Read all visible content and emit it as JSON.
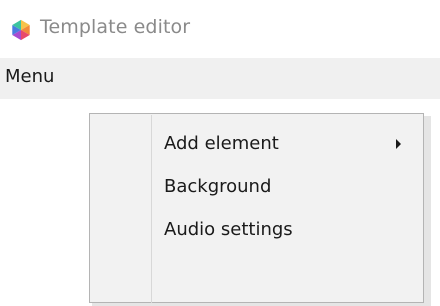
{
  "window": {
    "title": "Template editor",
    "icon": "app-logo-icon"
  },
  "menubar": {
    "menu_label": "Menu"
  },
  "context_menu": {
    "items": [
      {
        "label": "Add element",
        "has_submenu": true,
        "icon": "chevron-right-icon"
      },
      {
        "label": "Background",
        "has_submenu": false
      },
      {
        "label": "Audio settings",
        "has_submenu": false
      }
    ]
  }
}
